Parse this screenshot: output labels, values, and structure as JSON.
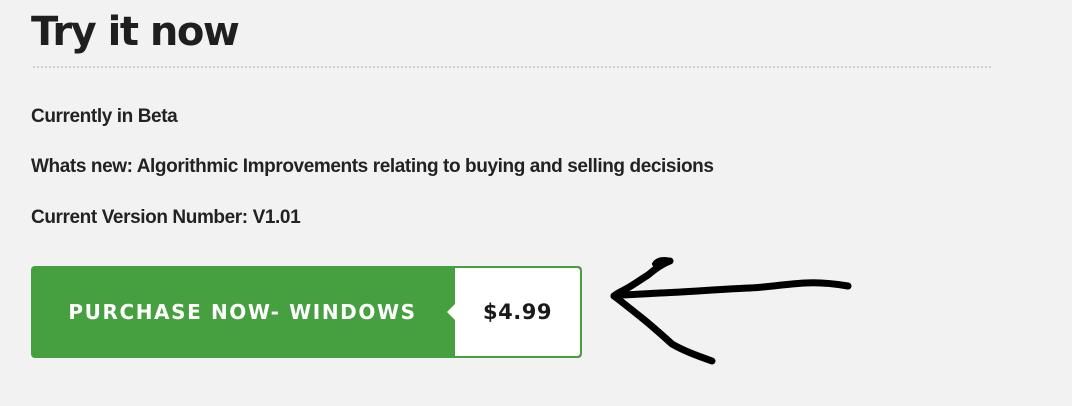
{
  "page": {
    "heading": "Try it now"
  },
  "info": {
    "status": "Currently in Beta",
    "whats_new": "Whats new: Algorithmic Improvements relating to buying and selling decisions",
    "version": "Current Version Number: V1.01"
  },
  "purchase": {
    "label": "PURCHASE NOW- WINDOWS",
    "price": "$4.99",
    "button_color": "#46a03f"
  },
  "annotation": {
    "icon": "hand-drawn-arrow-icon",
    "color": "#000000"
  }
}
